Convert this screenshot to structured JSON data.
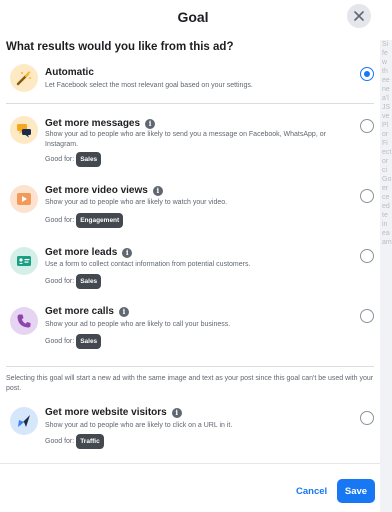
{
  "dialog": {
    "title": "Goal",
    "question": "What results would you like from this ad?",
    "good_for_label": "Good for:",
    "notice": "Selecting this goal will start a new ad with the same image and text as your post since this goal can't be used with your post."
  },
  "options": [
    {
      "title": "Automatic",
      "description": "Let Facebook select the most relevant goal based on your settings.",
      "selected": true,
      "icon": "magic-wand-icon"
    },
    {
      "title": "Get more messages",
      "description": "Show your ad to people who are likely to send you a message on Facebook, WhatsApp, or Instagram.",
      "badge": "Sales",
      "selected": false,
      "icon": "messages-icon"
    },
    {
      "title": "Get more video views",
      "description": "Show your ad to people who are likely to watch your video.",
      "badge": "Engagement",
      "selected": false,
      "icon": "video-icon"
    },
    {
      "title": "Get more leads",
      "description": "Use a form to collect contact information from potential customers.",
      "badge": "Sales",
      "selected": false,
      "icon": "lead-form-icon"
    },
    {
      "title": "Get more calls",
      "description": "Show your ad to people who are likely to call your business.",
      "badge": "Sales",
      "selected": false,
      "icon": "phone-icon"
    },
    {
      "title": "Get more website visitors",
      "description": "Show your ad to people who are likely to click on a URL in it.",
      "badge": "Traffic",
      "selected": false,
      "icon": "cursor-icon"
    }
  ],
  "footer": {
    "cancel_label": "Cancel",
    "save_label": "Save"
  },
  "colors": {
    "accent": "#1877f2",
    "badge_bg": "#444950"
  }
}
